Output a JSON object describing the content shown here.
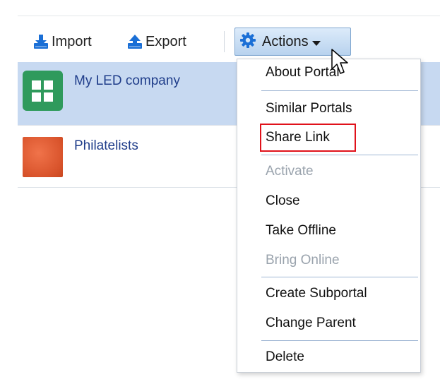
{
  "toolbar": {
    "import_label": "Import",
    "export_label": "Export",
    "actions_label": "Actions"
  },
  "portals": [
    {
      "name": "My LED company",
      "selected": true
    },
    {
      "name": "Philatelists",
      "selected": false
    }
  ],
  "menu": {
    "items": [
      {
        "label": "About Portal",
        "enabled": true
      },
      {
        "label": "Similar Portals",
        "enabled": true
      },
      {
        "label": "Share Link",
        "enabled": true,
        "highlighted": true
      },
      {
        "label": "Activate",
        "enabled": false
      },
      {
        "label": "Close",
        "enabled": true
      },
      {
        "label": "Take Offline",
        "enabled": true
      },
      {
        "label": "Bring Online",
        "enabled": false
      },
      {
        "label": "Create Subportal",
        "enabled": true
      },
      {
        "label": "Change Parent",
        "enabled": true
      },
      {
        "label": "Delete",
        "enabled": true
      }
    ]
  },
  "colors": {
    "selection": "#c7d9f1",
    "link": "#1f3d8a",
    "icon_blue": "#1a6fd6",
    "highlight_border": "#e0121b",
    "disabled_text": "#9aa3ad"
  }
}
